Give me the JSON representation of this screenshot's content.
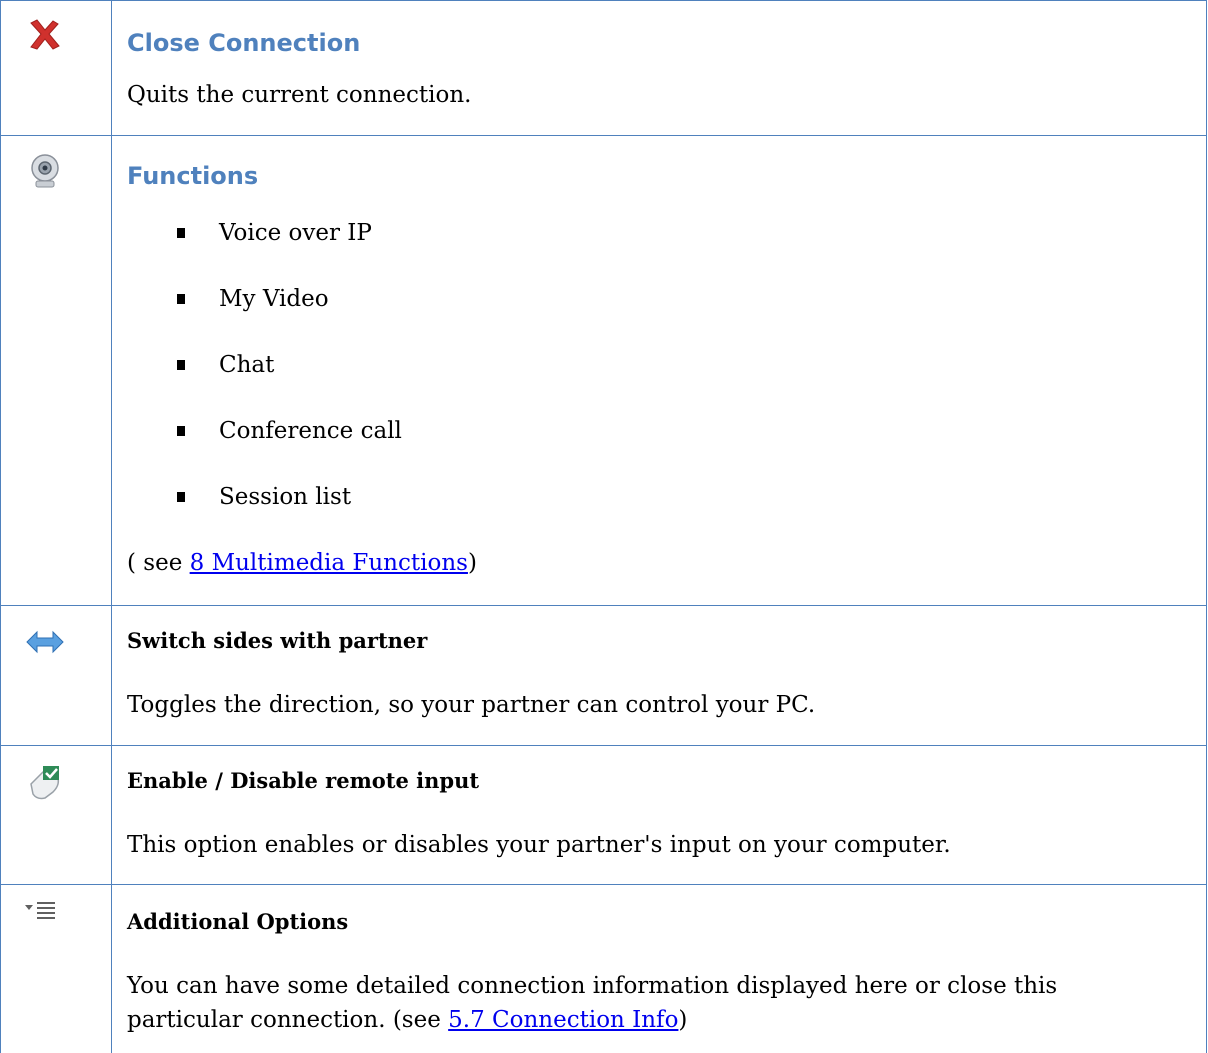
{
  "rows": [
    {
      "icon": "close-x-icon",
      "title": "Close Connection",
      "desc": "Quits the current connection."
    },
    {
      "icon": "webcam-icon",
      "title": "Functions",
      "items": [
        "Voice over IP",
        "My Video",
        "Chat",
        "Conference call",
        "Session list"
      ],
      "see_prefix": "( see ",
      "see_link": "8 Multimedia Functions",
      "see_suffix": ")"
    },
    {
      "icon": "switch-arrows-icon",
      "title": "Switch sides with partner",
      "desc": "Toggles the direction, so your partner can control your PC."
    },
    {
      "icon": "mouse-check-icon",
      "title": "Enable / Disable remote input",
      "desc": "This option enables or disables your partner's input on your computer."
    },
    {
      "icon": "options-menu-icon",
      "title": "Additional Options",
      "desc": "You can have some detailed connection information displayed here or close this particular connection. (see ",
      "link": "5.7 Connection Info",
      "suffix": ")"
    }
  ],
  "colors": {
    "border": "#4f81bd",
    "heading": "#4f81bd",
    "link": "#0000ee",
    "close_x": "#d0312d"
  }
}
